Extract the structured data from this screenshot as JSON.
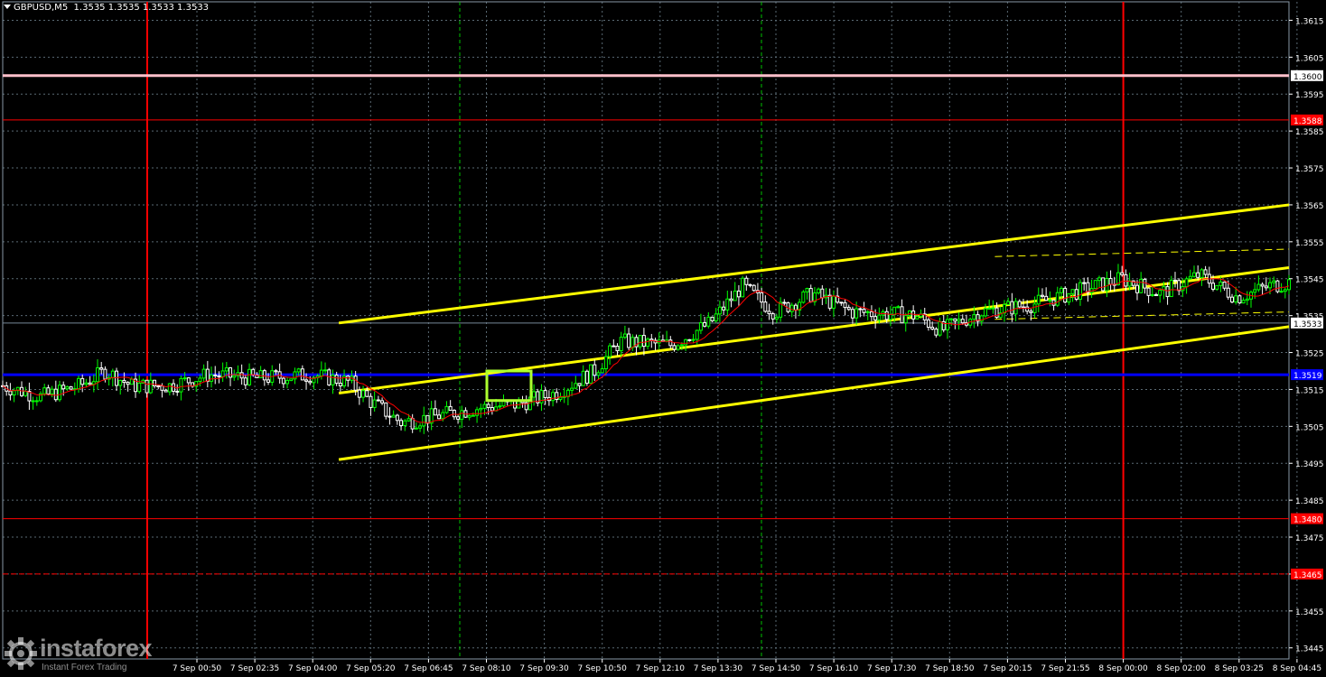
{
  "header": {
    "symbol": "GBPUSD,M5",
    "ohlc": "1.3535 1.3535 1.3533 1.3533"
  },
  "watermark": {
    "brand": "instaforex",
    "subtitle": "Instant Forex Trading",
    "icon": "gear-logo-icon"
  },
  "colors": {
    "background": "#000000",
    "grid": "#5a6a74",
    "bull_candle": "#00ff00",
    "moving_average": "#ff0000",
    "channel": "#ffff00",
    "level_blue": "#0000ff",
    "level_red": "#ff0000",
    "level_pink": "#ffc0cb",
    "session_red": "#ff0000",
    "session_green": "#00c000",
    "signal_box": "#adff2f"
  },
  "chart_data": {
    "type": "candlestick",
    "symbol": "GBPUSD",
    "timeframe": "M5",
    "y_range": [
      1.3442,
      1.362
    ],
    "y_ticks": [
      "1.3615",
      "1.3605",
      "1.3595",
      "1.3585",
      "1.3575",
      "1.3565",
      "1.3555",
      "1.3545",
      "1.3535",
      "1.3525",
      "1.3515",
      "1.3505",
      "1.3495",
      "1.3485",
      "1.3475",
      "1.3465",
      "1.3455",
      "1.3445"
    ],
    "x_ticks": [
      "7 Sep 00:50",
      "7 Sep 02:35",
      "7 Sep 04:00",
      "7 Sep 05:20",
      "7 Sep 06:45",
      "7 Sep 08:10",
      "7 Sep 09:30",
      "7 Sep 10:50",
      "7 Sep 12:10",
      "7 Sep 13:30",
      "7 Sep 14:50",
      "7 Sep 16:10",
      "7 Sep 17:30",
      "7 Sep 18:50",
      "7 Sep 20:15",
      "7 Sep 21:55",
      "8 Sep 00:00",
      "8 Sep 02:00",
      "8 Sep 03:25",
      "8 Sep 04:45"
    ],
    "price_path": [
      [
        0.0,
        1.3516
      ],
      [
        0.03,
        1.3513
      ],
      [
        0.06,
        1.3516
      ],
      [
        0.08,
        1.352
      ],
      [
        0.1,
        1.3516
      ],
      [
        0.13,
        1.3516
      ],
      [
        0.16,
        1.3519
      ],
      [
        0.2,
        1.3518
      ],
      [
        0.24,
        1.3519
      ],
      [
        0.27,
        1.3517
      ],
      [
        0.285,
        1.3512
      ],
      [
        0.31,
        1.3506
      ],
      [
        0.34,
        1.3508
      ],
      [
        0.37,
        1.351
      ],
      [
        0.4,
        1.3511
      ],
      [
        0.43,
        1.3514
      ],
      [
        0.46,
        1.352
      ],
      [
        0.48,
        1.3528
      ],
      [
        0.52,
        1.3527
      ],
      [
        0.55,
        1.3533
      ],
      [
        0.575,
        1.3543
      ],
      [
        0.6,
        1.3536
      ],
      [
        0.63,
        1.3541
      ],
      [
        0.66,
        1.3536
      ],
      [
        0.71,
        1.3535
      ],
      [
        0.73,
        1.3531
      ],
      [
        0.76,
        1.3536
      ],
      [
        0.8,
        1.3538
      ],
      [
        0.84,
        1.3542
      ],
      [
        0.87,
        1.3545
      ],
      [
        0.9,
        1.3541
      ],
      [
        0.93,
        1.3546
      ],
      [
        0.96,
        1.354
      ],
      [
        0.985,
        1.3543
      ],
      [
        1.0,
        1.3544
      ]
    ],
    "levels": [
      {
        "price": 1.36,
        "label": "1.3600",
        "color": "#ffc0cb",
        "style": "solid",
        "width": 3
      },
      {
        "price": 1.3588,
        "label": "1.3588",
        "color": "#ff0000",
        "style": "solid",
        "width": 1
      },
      {
        "price": 1.3519,
        "label": "1.3519",
        "color": "#0000ff",
        "style": "solid",
        "width": 3
      },
      {
        "price": 1.348,
        "label": "1.3480",
        "color": "#ff0000",
        "style": "solid",
        "width": 1
      },
      {
        "price": 1.3465,
        "label": "1.3465",
        "color": "#ff0000",
        "style": "dashed",
        "width": 1
      },
      {
        "price": 1.3533,
        "label": "1.3533",
        "color": "#778899",
        "style": "solid",
        "width": 1,
        "current": true
      }
    ],
    "channel": {
      "start_time": "7 Sep 02:35",
      "end_time": "8 Sep 04:45",
      "lines": [
        {
          "name": "upper",
          "start": 1.3533,
          "end": 1.3565
        },
        {
          "name": "middle",
          "start": 1.3514,
          "end": 1.3548
        },
        {
          "name": "lower",
          "start": 1.3496,
          "end": 1.3532
        }
      ],
      "dashed_projection": {
        "start_time": "7 Sep 20:15",
        "upper": 1.3551,
        "lower": 1.3534
      }
    },
    "session_markers": [
      {
        "time": "7 Sep 00:00",
        "color": "#ff0000",
        "style": "solid"
      },
      {
        "time": "7 Sep 08:00",
        "color": "#00c000",
        "style": "dashed"
      },
      {
        "time": "7 Sep 14:40",
        "color": "#00c000",
        "style": "dashed"
      },
      {
        "time": "8 Sep 00:00",
        "color": "#ff0000",
        "style": "solid"
      }
    ],
    "signal_box": {
      "time_from": "7 Sep 08:30",
      "time_to": "7 Sep 09:20",
      "price_from": 1.3512,
      "price_to": 1.352
    },
    "grid": true,
    "x_ticks_visible_date_prefix": "7 Sep"
  }
}
